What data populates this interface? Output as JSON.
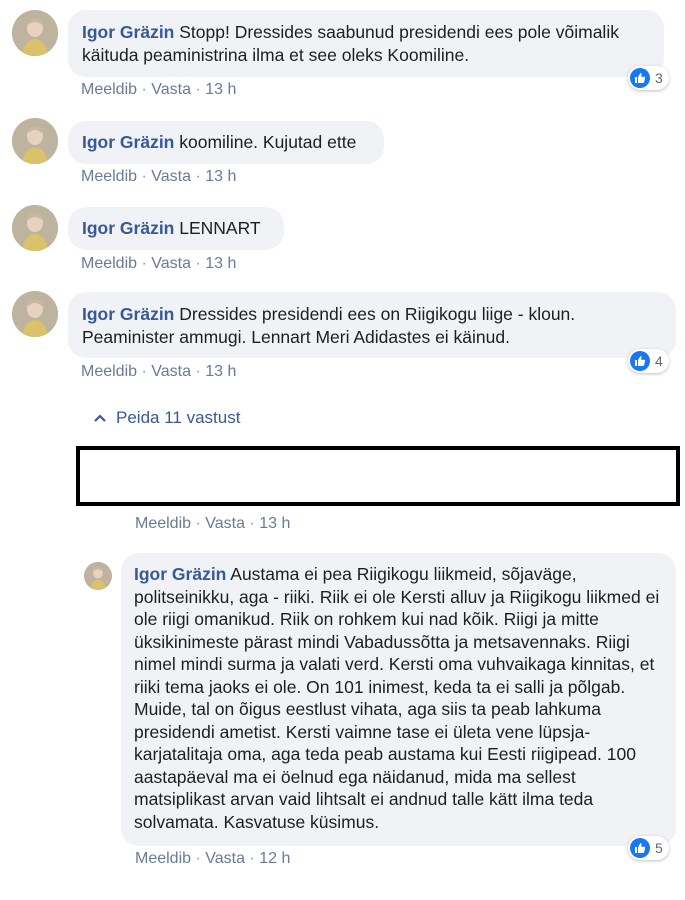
{
  "comments": [
    {
      "author": "Igor Gräzin",
      "text": "Stopp! Dressides saabunud presidendi ees pole võimalik käituda peaministrina ilma et see oleks Koomiline.",
      "actions": {
        "like": "Meeldib",
        "reply": "Vasta",
        "time": "13 h"
      },
      "reactions": "3"
    },
    {
      "author": "Igor Gräzin",
      "text": "koomiline. Kujutad ette",
      "actions": {
        "like": "Meeldib",
        "reply": "Vasta",
        "time": "13 h"
      }
    },
    {
      "author": "Igor Gräzin",
      "text": "LENNART",
      "actions": {
        "like": "Meeldib",
        "reply": "Vasta",
        "time": "13 h"
      }
    },
    {
      "author": "Igor Gräzin",
      "text": "Dressides presidendi ees on Riigikogu liige - kloun. Peaminister ammugi. Lennart Meri Adidastes ei käinud.",
      "actions": {
        "like": "Meeldib",
        "reply": "Vasta",
        "time": "13 h"
      },
      "reactions": "4"
    }
  ],
  "hide_replies": "Peida 11 vastust",
  "redacted_reply": {
    "actions": {
      "like": "Meeldib",
      "reply": "Vasta",
      "time": "13 h"
    }
  },
  "reply": {
    "author": "Igor Gräzin",
    "text": "Austama ei pea Riigikogu liikmeid, sõjaväge, politseinikku, aga - riiki. Riik ei ole Kersti alluv ja Riigikogu liikmed ei ole riigi omanikud. Riik on rohkem kui nad kõik. Riigi ja mitte üksikinimeste pärast mindi Vabadussõtta ja metsavennaks. Riigi nimel mindi surma ja valati verd. Kersti oma vuhvaikaga kinnitas, et riiki tema jaoks ei ole. On 101 inimest, keda ta ei salli ja põlgab. Muide, tal on õigus eestlust vihata, aga siis ta peab lahkuma presidendi ametist. Kersti vaimne tase ei ületa vene lüpsja-karjatalitaja oma, aga teda peab austama kui Eesti riigipead. 100 aastapäeval ma ei öelnud ega näidanud, mida ma sellest matsiplikast arvan vaid lihtsalt ei andnud talle kätt ilma teda solvamata. Kasvatuse küsimus.",
    "actions": {
      "like": "Meeldib",
      "reply": "Vasta",
      "time": "12 h"
    },
    "reactions": "5"
  },
  "colors": {
    "author": "#385898",
    "bubble": "#f0f2f5",
    "like": "#1877f2",
    "action": "#6b7a99"
  }
}
